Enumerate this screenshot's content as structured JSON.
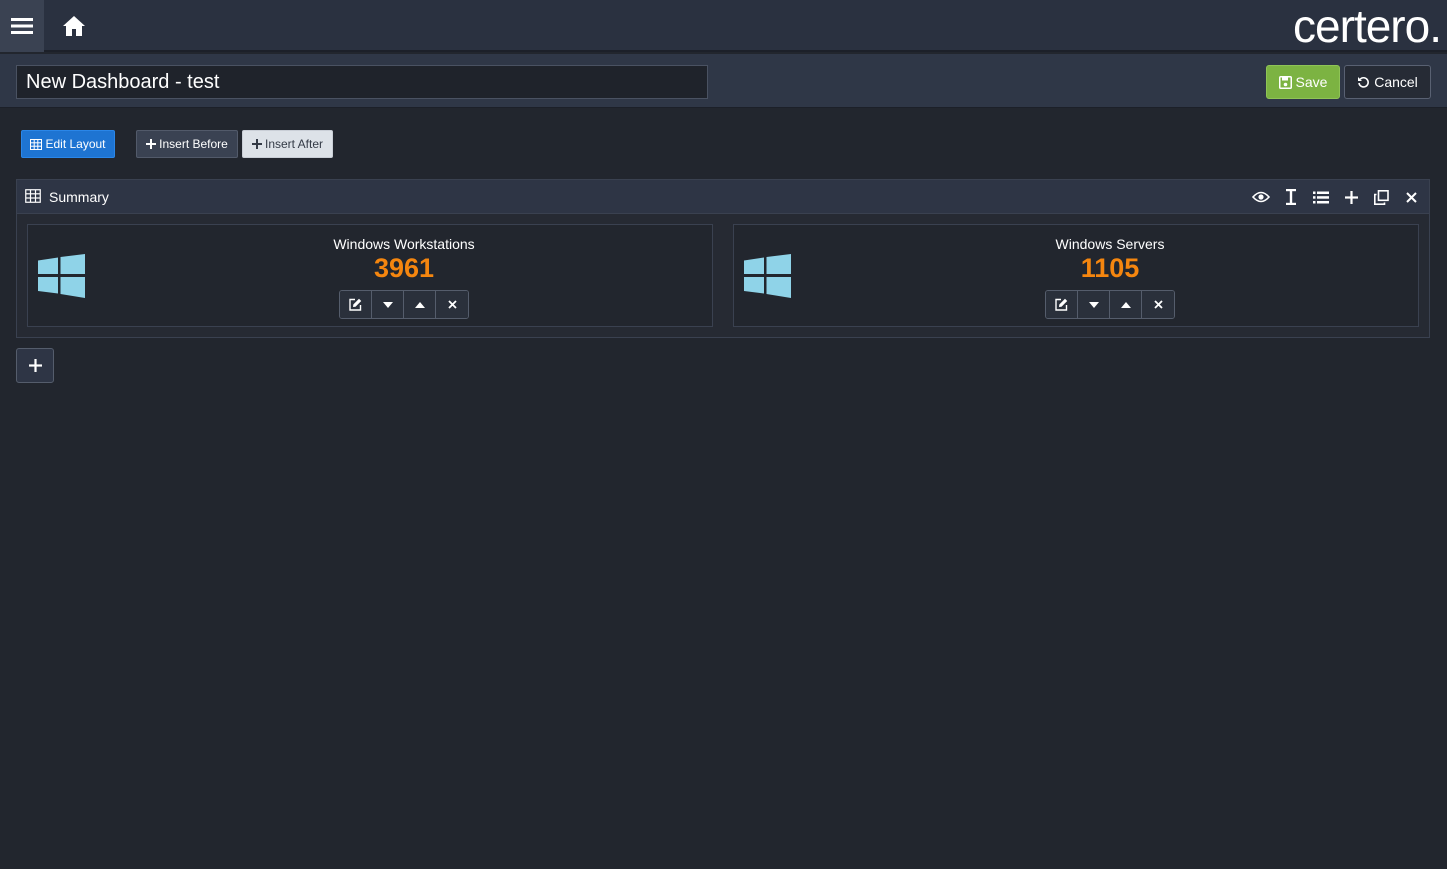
{
  "header": {
    "logo_text": "certero.",
    "menu_icon": "hamburger-icon",
    "home_icon": "home-icon"
  },
  "titlebar": {
    "dashboard_title": "New Dashboard - test",
    "save_label": "Save",
    "cancel_label": "Cancel"
  },
  "toolbar": {
    "edit_layout_label": "Edit Layout",
    "insert_before_label": "Insert Before",
    "insert_after_label": "Insert After"
  },
  "panel": {
    "title": "Summary",
    "actions": [
      "eye-icon",
      "text-cursor-icon",
      "list-icon",
      "plus-icon",
      "clone-icon",
      "close-icon"
    ]
  },
  "cards": [
    {
      "title": "Windows Workstations",
      "value": "3961",
      "icon": "windows-icon"
    },
    {
      "title": "Windows Servers",
      "value": "1105",
      "icon": "windows-icon"
    }
  ],
  "colors": {
    "background": "#22262e",
    "accent_value": "#f5860f",
    "save_green": "#7cb342",
    "edit_blue": "#1e74d2",
    "windows_logo": "#8fd3e8"
  }
}
